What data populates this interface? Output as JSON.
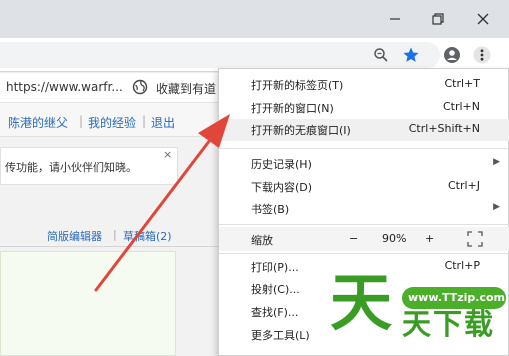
{
  "window": {
    "minimize_icon": "minimize-icon",
    "restore_icon": "restore-icon",
    "close_icon": "close-icon"
  },
  "toolbar": {
    "zoom_icon": "zoom-icon",
    "bookmark_icon": "star-icon",
    "account_icon": "account-icon",
    "menu_icon": "more-vert-icon"
  },
  "page": {
    "url_text": "https://www.warfr...",
    "collect_text": "收藏到有道",
    "user_links": [
      "陈港的继父",
      "我的经验",
      "退出"
    ],
    "notice_text": "传功能，请小伙伴们知晓。",
    "notice_close": "×",
    "editor_links": [
      "简版编辑器",
      "草稿箱(2)"
    ]
  },
  "menu": {
    "items_top": [
      {
        "label": "打开新的标签页(T)",
        "shortcut": "Ctrl+T"
      },
      {
        "label": "打开新的窗口(N)",
        "shortcut": "Ctrl+N"
      },
      {
        "label": "打开新的无痕窗口(I)",
        "shortcut": "Ctrl+Shift+N"
      }
    ],
    "items_mid": [
      {
        "label": "历史记录(H)",
        "shortcut": ""
      },
      {
        "label": "下载内容(D)",
        "shortcut": "Ctrl+J"
      },
      {
        "label": "书签(B)",
        "shortcut": ""
      }
    ],
    "zoom": {
      "label": "缩放",
      "minus": "−",
      "value": "90%",
      "plus": "+",
      "fullscreen_icon": "fullscreen-icon"
    },
    "items_bottom": [
      {
        "label": "打印(P)...",
        "shortcut": "Ctrl+P"
      },
      {
        "label": "投射(C)...",
        "shortcut": ""
      },
      {
        "label": "查找(F)...",
        "shortcut": ""
      },
      {
        "label": "更多工具(L)",
        "shortcut": ""
      }
    ],
    "submenu_arrow": "▶"
  },
  "watermark": {
    "badge": "www.TTzip.com",
    "big": "天",
    "small": "天下载"
  },
  "colors": {
    "accent_blue": "#2a6bb5",
    "bookmark_star": "#1a73e8",
    "arrow_red": "#e0473a",
    "watermark_green": "#3a9d23"
  }
}
